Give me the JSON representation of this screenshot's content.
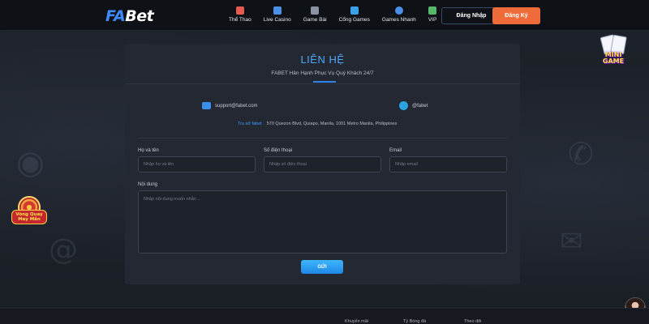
{
  "header": {
    "logo_fa": "FA",
    "logo_bet": "Bet",
    "nav": [
      {
        "label": "Thể Thao",
        "icon": "rocket-icon",
        "color": "#e85a4f"
      },
      {
        "label": "Live Casino",
        "icon": "casino-icon",
        "color": "#4c8fe6"
      },
      {
        "label": "Game Bài",
        "icon": "cards-icon",
        "color": "#8b93a3"
      },
      {
        "label": "Cổng Games",
        "icon": "lightning-icon",
        "color": "#3aa0e8"
      },
      {
        "label": "Games Nhanh",
        "icon": "globe-icon",
        "color": "#4c8fe6"
      },
      {
        "label": "VIP",
        "icon": "trophy-icon",
        "color": "#58b86a"
      }
    ],
    "login_label": "Đăng Nhập",
    "register_label": "Đăng Ký"
  },
  "contact": {
    "title": "LIÊN HỆ",
    "subtitle": "FABET Hân Hạnh Phục Vụ Quý Khách 24/7",
    "email": "support@fabet.com",
    "telegram": "@fabet",
    "address_label": "Trụ sở fabet",
    "address": "570 Quezon Blvd, Quiapo, Manila, 1001 Metro Manila, Philippines"
  },
  "form": {
    "name_label": "Họ và tên",
    "name_placeholder": "Nhập họ và tên",
    "phone_label": "Số điện thoại",
    "phone_placeholder": "Nhập số điện thoại",
    "email_label": "Email",
    "email_placeholder": "Nhập email",
    "content_label": "Nội dung",
    "content_placeholder": "Nhập nội dung muốn nhắn ...",
    "send_label": "GỬI"
  },
  "widgets": {
    "mini_game": "MINI GAME",
    "lucky_wheel": "Vòng Quay May Mắn"
  },
  "footer": {
    "links": [
      "Khuyến mãi",
      "Tỷ Bóng đá",
      "Theo dõi"
    ]
  },
  "colors": {
    "accent": "#2f86e8",
    "register": "#f06b3a",
    "panel": "#232833"
  }
}
